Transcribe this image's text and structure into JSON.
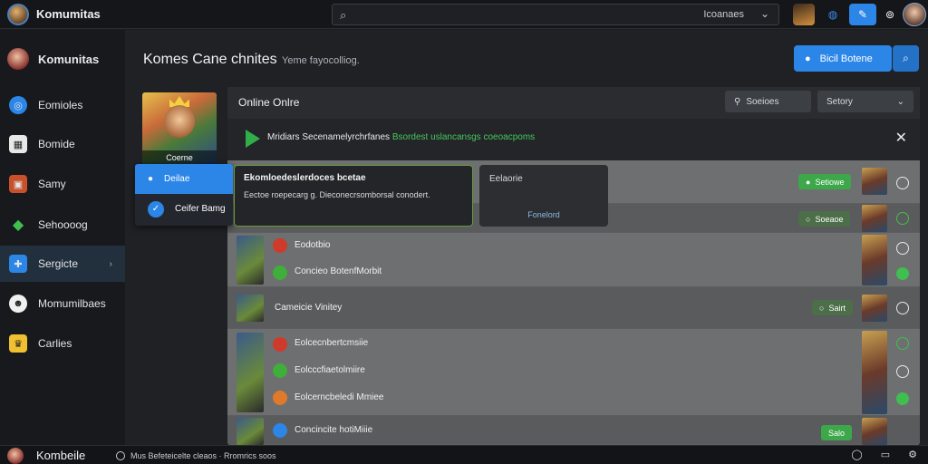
{
  "app": {
    "title": "Komumitas",
    "search_placeholder": "",
    "search_filter": "Icoanaes"
  },
  "sidebar": {
    "header": "Komunitas",
    "items": [
      {
        "label": "Eomioles",
        "icon": "compass-icon"
      },
      {
        "label": "Bomide",
        "icon": "store-icon"
      },
      {
        "label": "Samy",
        "icon": "controller-icon"
      },
      {
        "label": "Sehoooog",
        "icon": "diamond-icon"
      },
      {
        "label": "Sergicte",
        "icon": "puzzle-icon"
      },
      {
        "label": "Momumilbaes",
        "icon": "discord-icon"
      },
      {
        "label": "Carlies",
        "icon": "trophy-icon"
      }
    ]
  },
  "main": {
    "title": "Komes Cane chnites",
    "subtitle": "Yeme fayocolliog.",
    "primary_button": "Bicil Botene",
    "game_thumb_label": "Coerne"
  },
  "dropdown": {
    "items": [
      "Deilae",
      "Ceifer Bamg"
    ]
  },
  "panel": {
    "title": "Online Onlre",
    "filters": [
      "Soeioes",
      "Setory"
    ],
    "notice": {
      "text": "Mridiars Secenamelyrchrfanes",
      "link": "Bsordest uslancansgs coeoacpoms"
    },
    "popover": {
      "title": "Ekomloedeslerdoces bcetae",
      "text": "Eectoe roepecarg g. Dieconecrsomborsal conodert."
    },
    "popover2": {
      "title": "Eelaorie",
      "button": "Fonelord"
    },
    "rows": [
      {
        "label": "",
        "badge": "Setiowe"
      },
      {
        "label": "",
        "badge": "Soeaoe"
      },
      {
        "sub": [
          "Eodotbio",
          "Concieo BotenfMorbit"
        ]
      },
      {
        "label": "Cameicie Vinitey",
        "badge": "Sairt"
      },
      {
        "sub": [
          "Eolcecnbertcmsiie",
          "Eolcccfiaetolmiire",
          "Eolcerncbeledi Mmiee"
        ]
      },
      {
        "sub": [
          "Concincite hotiMiiie"
        ],
        "badge": "Salo"
      }
    ]
  },
  "footer": {
    "title": "Kombeile",
    "status": "Mus Befeteicelte cleaos · Rromrics soos"
  },
  "colors": {
    "accent": "#2c86e8",
    "success": "#3da84a"
  }
}
